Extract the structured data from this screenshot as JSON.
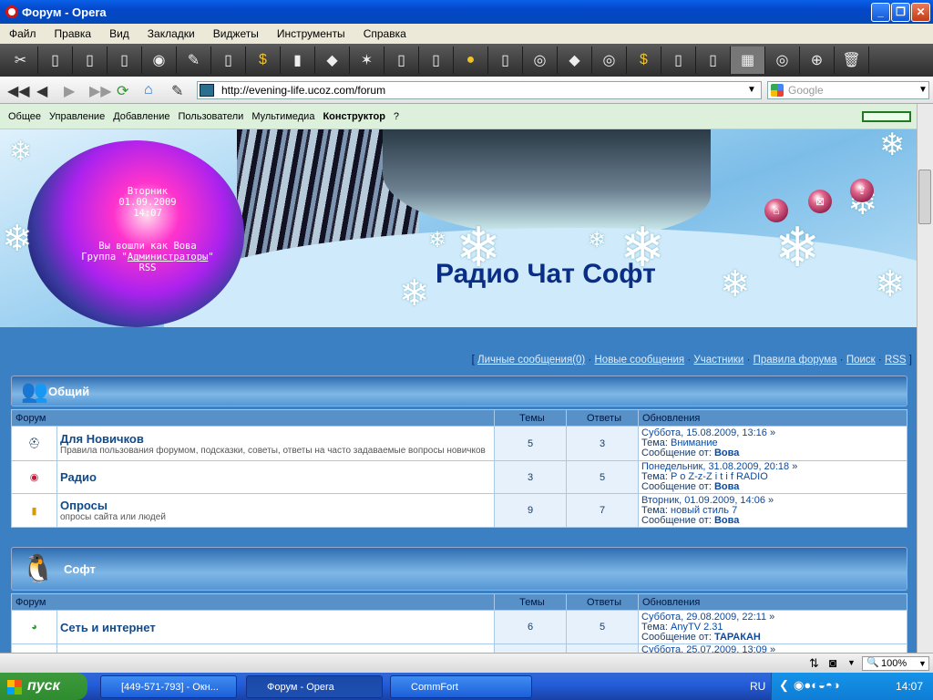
{
  "window": {
    "title": "Форум - Opera"
  },
  "menu": [
    "Файл",
    "Правка",
    "Вид",
    "Закладки",
    "Виджеты",
    "Инструменты",
    "Справка"
  ],
  "address": {
    "url": "http://evening-life.ucoz.com/forum",
    "search_placeholder": "Google"
  },
  "ucoz_menu": {
    "items": [
      "Общее",
      "Управление",
      "Добавление",
      "Пользователи",
      "Мультимедиа",
      "Конструктор",
      "?"
    ],
    "active": "Конструктор"
  },
  "header": {
    "site_title": "Радио Чат Софт",
    "day": "Вторник",
    "date": "01.09.2009",
    "time": "14:07",
    "login_text": "Вы вошли как Вова",
    "group_prefix": "Группа \"",
    "group_name": "Администраторы",
    "group_suffix": "\"",
    "rss": "RSS"
  },
  "top_links": {
    "open": "[",
    "close": "]",
    "sep": "·",
    "items": [
      "Личные сообщения(0)",
      "Новые сообщения",
      "Участники",
      "Правила форума",
      "Поиск",
      "RSS"
    ]
  },
  "table_headers": {
    "forum": "Форум",
    "topics": "Темы",
    "replies": "Ответы",
    "updates": "Обновления"
  },
  "labels": {
    "topic": "Тема:",
    "message_from": "Сообщение от:"
  },
  "categories": [
    {
      "name": "Общий",
      "icon": "users-icon",
      "forums": [
        {
          "title": "Для Новичков",
          "desc": "Правила пользования форумом, подсказки, советы, ответы на часто задаваемые вопросы новичков",
          "topics": "5",
          "replies": "3",
          "date": "Суббота, 15.08.2009, 13:16",
          "topic": "Внимание",
          "user": "Вова",
          "icon": "lifebuoy-icon"
        },
        {
          "title": "Радио",
          "desc": "",
          "topics": "3",
          "replies": "5",
          "date": "Понедельник, 31.08.2009, 20:18",
          "topic": "P o Z-z-Z i t i f RADIO",
          "user": "Вова",
          "icon": "radio-icon"
        },
        {
          "title": "Опросы",
          "desc": "опросы сайта или людей",
          "topics": "9",
          "replies": "7",
          "date": "Вторник, 01.09.2009, 14:06",
          "topic": "новый стиль 7",
          "user": "Вова",
          "icon": "poll-icon"
        }
      ]
    },
    {
      "name": "Софт",
      "icon": "penguin-icon",
      "forums": [
        {
          "title": "Сеть и интернет",
          "desc": "",
          "topics": "6",
          "replies": "5",
          "date": "Суббота, 29.08.2009, 22:11",
          "topic": "AnyTV 2.31",
          "user": "ТАРАКАН",
          "icon": "network-icon"
        },
        {
          "title": "",
          "desc": "",
          "topics": "",
          "replies": "",
          "date": "Суббота, 25.07.2009, 13:09",
          "topic": "",
          "user": "",
          "icon": "software-icon"
        }
      ]
    }
  ],
  "status": {
    "zoom": "100%"
  },
  "taskbar": {
    "start": "пуск",
    "tasks": [
      "[449-571-793] - Окн...",
      "Форум - Opera",
      "CommFort"
    ],
    "lang": "RU",
    "clock": "14:07"
  },
  "colors": {
    "title_bar": "#0a60e8",
    "ucoz_bar": "#dcf0dc",
    "page_bg": "#3c80c4",
    "site_title": "#0a2e85",
    "link": "#0b4aa2"
  }
}
